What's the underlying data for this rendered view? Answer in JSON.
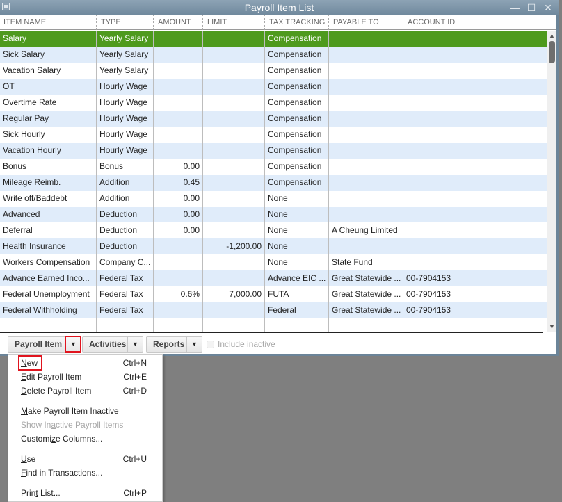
{
  "window": {
    "title": "Payroll Item List",
    "controls": [
      "minimize",
      "maximize",
      "close"
    ]
  },
  "columns": [
    "ITEM NAME",
    "TYPE",
    "AMOUNT",
    "LIMIT",
    "TAX TRACKING",
    "PAYABLE TO",
    "ACCOUNT ID"
  ],
  "rows": [
    {
      "name": "Salary",
      "type": "Yearly Salary",
      "amount": "",
      "limit": "",
      "tax": "Compensation",
      "payable": "",
      "account": "",
      "selected": true
    },
    {
      "name": "Sick Salary",
      "type": "Yearly Salary",
      "amount": "",
      "limit": "",
      "tax": "Compensation",
      "payable": "",
      "account": ""
    },
    {
      "name": "Vacation Salary",
      "type": "Yearly Salary",
      "amount": "",
      "limit": "",
      "tax": "Compensation",
      "payable": "",
      "account": ""
    },
    {
      "name": "OT",
      "type": "Hourly Wage",
      "amount": "",
      "limit": "",
      "tax": "Compensation",
      "payable": "",
      "account": ""
    },
    {
      "name": "Overtime Rate",
      "type": "Hourly Wage",
      "amount": "",
      "limit": "",
      "tax": "Compensation",
      "payable": "",
      "account": ""
    },
    {
      "name": "Regular Pay",
      "type": "Hourly Wage",
      "amount": "",
      "limit": "",
      "tax": "Compensation",
      "payable": "",
      "account": ""
    },
    {
      "name": "Sick Hourly",
      "type": "Hourly Wage",
      "amount": "",
      "limit": "",
      "tax": "Compensation",
      "payable": "",
      "account": ""
    },
    {
      "name": "Vacation Hourly",
      "type": "Hourly Wage",
      "amount": "",
      "limit": "",
      "tax": "Compensation",
      "payable": "",
      "account": ""
    },
    {
      "name": "Bonus",
      "type": "Bonus",
      "amount": "0.00",
      "limit": "",
      "tax": "Compensation",
      "payable": "",
      "account": ""
    },
    {
      "name": "Mileage Reimb.",
      "type": "Addition",
      "amount": "0.45",
      "limit": "",
      "tax": "Compensation",
      "payable": "",
      "account": ""
    },
    {
      "name": "Write off/Baddebt",
      "type": "Addition",
      "amount": "0.00",
      "limit": "",
      "tax": "None",
      "payable": "",
      "account": ""
    },
    {
      "name": "Advanced",
      "type": "Deduction",
      "amount": "0.00",
      "limit": "",
      "tax": "None",
      "payable": "",
      "account": ""
    },
    {
      "name": "Deferral",
      "type": "Deduction",
      "amount": "0.00",
      "limit": "",
      "tax": "None",
      "payable": "A Cheung Limited",
      "account": ""
    },
    {
      "name": "Health Insurance",
      "type": "Deduction",
      "amount": "",
      "limit": "-1,200.00",
      "tax": "None",
      "payable": "",
      "account": ""
    },
    {
      "name": "Workers Compensation",
      "type": "Company C...",
      "amount": "",
      "limit": "",
      "tax": "None",
      "payable": "State Fund",
      "account": ""
    },
    {
      "name": "Advance Earned Inco...",
      "type": "Federal Tax",
      "amount": "",
      "limit": "",
      "tax": "Advance EIC ...",
      "payable": "Great Statewide ...",
      "account": "00-7904153"
    },
    {
      "name": "Federal Unemployment",
      "type": "Federal Tax",
      "amount": "0.6%",
      "limit": "7,000.00",
      "tax": "FUTA",
      "payable": "Great Statewide ...",
      "account": "00-7904153"
    },
    {
      "name": "Federal Withholding",
      "type": "Federal Tax",
      "amount": "",
      "limit": "",
      "tax": "Federal",
      "payable": "Great Statewide ...",
      "account": "00-7904153"
    },
    {
      "name": "",
      "type": "",
      "amount": "",
      "limit": "",
      "tax": "",
      "payable": "",
      "account": ""
    }
  ],
  "toolbar": {
    "payroll_item": "Payroll Item",
    "activities": "Activities",
    "reports": "Reports",
    "include_inactive": "Include inactive",
    "include_inactive_checked": false
  },
  "menu": {
    "items": [
      {
        "label": "New",
        "shortcut": "Ctrl+N",
        "enabled": true,
        "highlighted": true
      },
      {
        "label": "Edit Payroll Item",
        "shortcut": "Ctrl+E",
        "enabled": true
      },
      {
        "label": "Delete Payroll Item",
        "shortcut": "Ctrl+D",
        "enabled": true
      },
      {
        "label": "Make Payroll Item Inactive",
        "shortcut": "",
        "enabled": true
      },
      {
        "label": "Show Inactive Payroll Items",
        "shortcut": "",
        "enabled": false
      },
      {
        "label": "Customize Columns...",
        "shortcut": "",
        "enabled": true
      },
      {
        "label": "Use",
        "shortcut": "Ctrl+U",
        "enabled": true
      },
      {
        "label": "Find in Transactions...",
        "shortcut": "",
        "enabled": true
      },
      {
        "label": "Print List...",
        "shortcut": "Ctrl+P",
        "enabled": true
      }
    ]
  },
  "colors": {
    "selected_row": "#4e9a1d",
    "alt_row": "#e0ecfa",
    "highlight_box": "#e0141e"
  }
}
